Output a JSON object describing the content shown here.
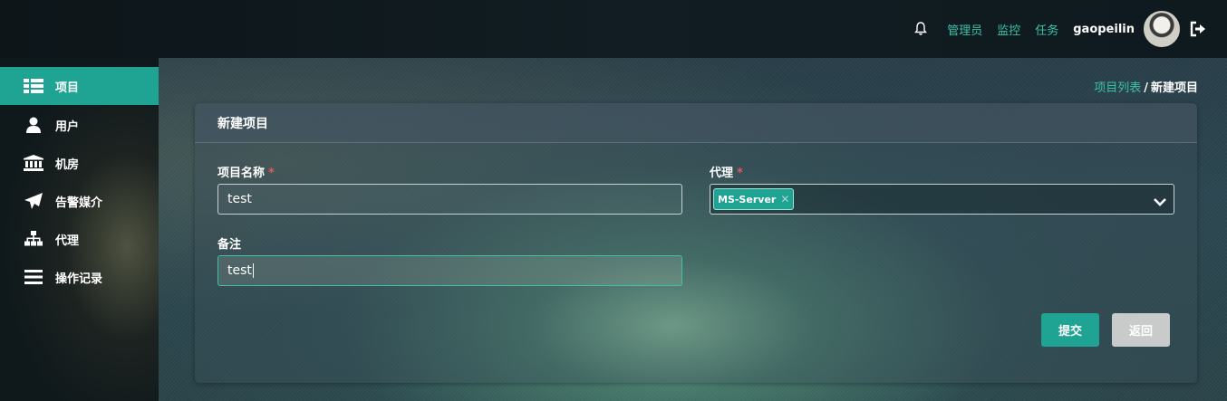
{
  "topbar": {
    "links": [
      "管理员",
      "监控",
      "任务"
    ],
    "username": "gaopeilin",
    "icons": [
      "bell-icon",
      "avatar",
      "logout-icon"
    ]
  },
  "sidebar": {
    "items": [
      {
        "label": "项目",
        "icon": "table-list-icon",
        "active": true
      },
      {
        "label": "用户",
        "icon": "user-icon",
        "active": false
      },
      {
        "label": "机房",
        "icon": "bank-icon",
        "active": false
      },
      {
        "label": "告警媒介",
        "icon": "paper-plane-icon",
        "active": false
      },
      {
        "label": "代理",
        "icon": "sitemap-icon",
        "active": false
      },
      {
        "label": "操作记录",
        "icon": "bars-icon",
        "active": false
      }
    ]
  },
  "breadcrumb": {
    "link": "项目列表",
    "separator": "/",
    "current": "新建项目"
  },
  "form": {
    "title": "新建项目",
    "name_label": "项目名称",
    "name_value": "test",
    "proxy_label": "代理",
    "proxy_selected": "MS-Server",
    "remark_label": "备注",
    "remark_value": "test",
    "required_mark": "*",
    "submit_label": "提交",
    "back_label": "返回"
  },
  "colors": {
    "accent": "#1fa392",
    "link": "#3cc2a8",
    "required": "#e05a5a",
    "button_secondary": "#c9cbcb"
  }
}
